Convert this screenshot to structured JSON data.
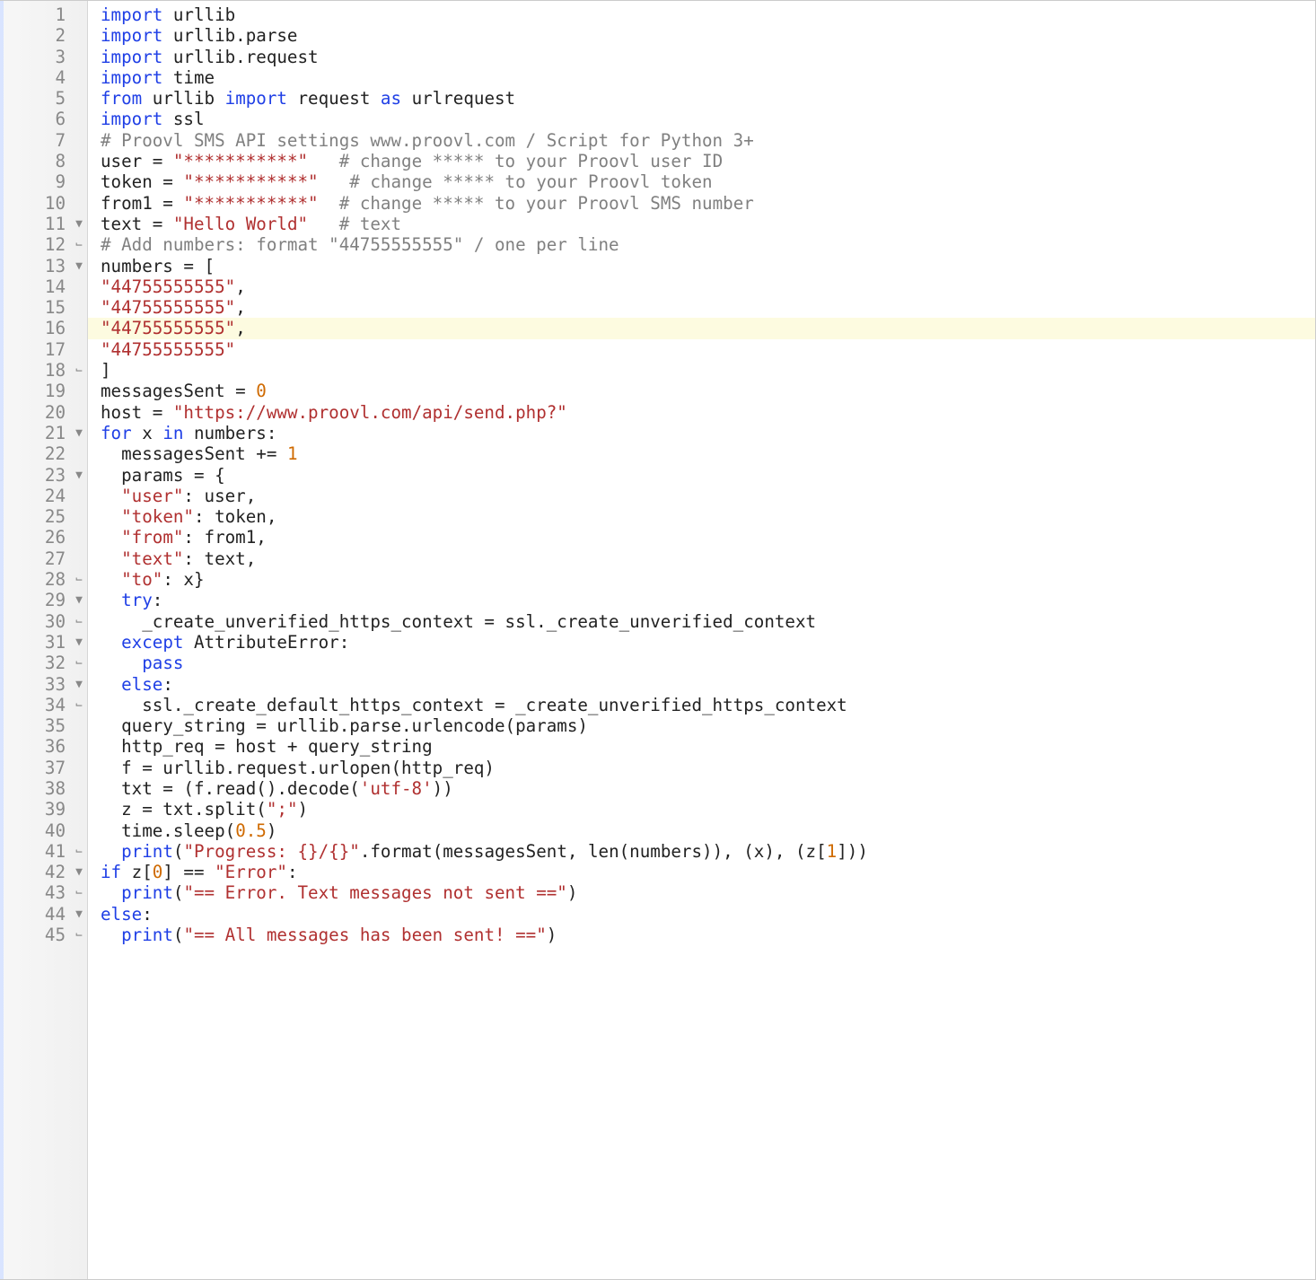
{
  "lines": [
    {
      "n": 1,
      "fold": "",
      "hl": false,
      "tokens": [
        [
          "kw",
          "import"
        ],
        [
          "name",
          " urllib"
        ]
      ]
    },
    {
      "n": 2,
      "fold": "",
      "hl": false,
      "tokens": [
        [
          "kw",
          "import"
        ],
        [
          "name",
          " urllib.parse"
        ]
      ]
    },
    {
      "n": 3,
      "fold": "",
      "hl": false,
      "tokens": [
        [
          "kw",
          "import"
        ],
        [
          "name",
          " urllib.request"
        ]
      ]
    },
    {
      "n": 4,
      "fold": "",
      "hl": false,
      "tokens": [
        [
          "kw",
          "import"
        ],
        [
          "name",
          " time"
        ]
      ]
    },
    {
      "n": 5,
      "fold": "",
      "hl": false,
      "tokens": [
        [
          "kw",
          "from"
        ],
        [
          "name",
          " urllib "
        ],
        [
          "kw",
          "import"
        ],
        [
          "name",
          " request "
        ],
        [
          "kw",
          "as"
        ],
        [
          "name",
          " urlrequest"
        ]
      ]
    },
    {
      "n": 6,
      "fold": "",
      "hl": false,
      "tokens": [
        [
          "kw",
          "import"
        ],
        [
          "name",
          " ssl"
        ]
      ]
    },
    {
      "n": 7,
      "fold": "",
      "hl": false,
      "tokens": [
        [
          "cmt",
          "# Proovl SMS API settings www.proovl.com / Script for Python 3+"
        ]
      ]
    },
    {
      "n": 8,
      "fold": "",
      "hl": false,
      "tokens": [
        [
          "name",
          "user = "
        ],
        [
          "str",
          "\"***********\""
        ],
        [
          "name",
          "   "
        ],
        [
          "cmt",
          "# change ***** to your Proovl user ID"
        ]
      ]
    },
    {
      "n": 9,
      "fold": "",
      "hl": false,
      "tokens": [
        [
          "name",
          "token = "
        ],
        [
          "str",
          "\"***********\""
        ],
        [
          "name",
          "   "
        ],
        [
          "cmt",
          "# change ***** to your Proovl token"
        ]
      ]
    },
    {
      "n": 10,
      "fold": "",
      "hl": false,
      "tokens": [
        [
          "name",
          "from1 = "
        ],
        [
          "str",
          "\"***********\""
        ],
        [
          "name",
          "  "
        ],
        [
          "cmt",
          "# change ***** to your Proovl SMS number"
        ]
      ]
    },
    {
      "n": 11,
      "fold": "▼",
      "hl": false,
      "tokens": [
        [
          "name",
          "text = "
        ],
        [
          "str",
          "\"Hello World\""
        ],
        [
          "name",
          "   "
        ],
        [
          "cmt",
          "# text"
        ]
      ]
    },
    {
      "n": 12,
      "fold": "⌙",
      "hl": false,
      "tokens": [
        [
          "cmt",
          "# Add numbers: format \"44755555555\" / one per line"
        ]
      ]
    },
    {
      "n": 13,
      "fold": "▼",
      "hl": false,
      "tokens": [
        [
          "name",
          "numbers = ["
        ]
      ]
    },
    {
      "n": 14,
      "fold": "",
      "hl": false,
      "tokens": [
        [
          "str",
          "\"44755555555\""
        ],
        [
          "name",
          ","
        ]
      ]
    },
    {
      "n": 15,
      "fold": "",
      "hl": false,
      "tokens": [
        [
          "str",
          "\"44755555555\""
        ],
        [
          "name",
          ","
        ]
      ]
    },
    {
      "n": 16,
      "fold": "",
      "hl": true,
      "tokens": [
        [
          "str",
          "\"44755555555\""
        ],
        [
          "name",
          ","
        ]
      ]
    },
    {
      "n": 17,
      "fold": "",
      "hl": false,
      "tokens": [
        [
          "str",
          "\"44755555555\""
        ]
      ]
    },
    {
      "n": 18,
      "fold": "⌙",
      "hl": false,
      "tokens": [
        [
          "name",
          "]"
        ]
      ]
    },
    {
      "n": 19,
      "fold": "",
      "hl": false,
      "tokens": [
        [
          "name",
          "messagesSent = "
        ],
        [
          "num",
          "0"
        ]
      ]
    },
    {
      "n": 20,
      "fold": "",
      "hl": false,
      "tokens": [
        [
          "name",
          "host = "
        ],
        [
          "str",
          "\"https://www.proovl.com/api/send.php?\""
        ]
      ]
    },
    {
      "n": 21,
      "fold": "▼",
      "hl": false,
      "tokens": [
        [
          "kw",
          "for"
        ],
        [
          "name",
          " x "
        ],
        [
          "kw",
          "in"
        ],
        [
          "name",
          " numbers:"
        ]
      ]
    },
    {
      "n": 22,
      "fold": "",
      "hl": false,
      "tokens": [
        [
          "name",
          "  messagesSent += "
        ],
        [
          "num",
          "1"
        ]
      ]
    },
    {
      "n": 23,
      "fold": "▼",
      "hl": false,
      "tokens": [
        [
          "name",
          "  params = {"
        ]
      ]
    },
    {
      "n": 24,
      "fold": "",
      "hl": false,
      "tokens": [
        [
          "name",
          "  "
        ],
        [
          "str",
          "\"user\""
        ],
        [
          "name",
          ": user,"
        ]
      ]
    },
    {
      "n": 25,
      "fold": "",
      "hl": false,
      "tokens": [
        [
          "name",
          "  "
        ],
        [
          "str",
          "\"token\""
        ],
        [
          "name",
          ": token,"
        ]
      ]
    },
    {
      "n": 26,
      "fold": "",
      "hl": false,
      "tokens": [
        [
          "name",
          "  "
        ],
        [
          "str",
          "\"from\""
        ],
        [
          "name",
          ": from1,"
        ]
      ]
    },
    {
      "n": 27,
      "fold": "",
      "hl": false,
      "tokens": [
        [
          "name",
          "  "
        ],
        [
          "str",
          "\"text\""
        ],
        [
          "name",
          ": text,"
        ]
      ]
    },
    {
      "n": 28,
      "fold": "⌙",
      "hl": false,
      "tokens": [
        [
          "name",
          "  "
        ],
        [
          "str",
          "\"to\""
        ],
        [
          "name",
          ": x}"
        ]
      ]
    },
    {
      "n": 29,
      "fold": "▼",
      "hl": false,
      "tokens": [
        [
          "name",
          "  "
        ],
        [
          "kw",
          "try"
        ],
        [
          "name",
          ":"
        ]
      ]
    },
    {
      "n": 30,
      "fold": "⌙",
      "hl": false,
      "tokens": [
        [
          "name",
          "    _create_unverified_https_context = ssl._create_unverified_context"
        ]
      ]
    },
    {
      "n": 31,
      "fold": "▼",
      "hl": false,
      "tokens": [
        [
          "name",
          "  "
        ],
        [
          "kw",
          "except"
        ],
        [
          "name",
          " AttributeError:"
        ]
      ]
    },
    {
      "n": 32,
      "fold": "⌙",
      "hl": false,
      "tokens": [
        [
          "name",
          "    "
        ],
        [
          "kw",
          "pass"
        ]
      ]
    },
    {
      "n": 33,
      "fold": "▼",
      "hl": false,
      "tokens": [
        [
          "name",
          "  "
        ],
        [
          "kw",
          "else"
        ],
        [
          "name",
          ":"
        ]
      ]
    },
    {
      "n": 34,
      "fold": "⌙",
      "hl": false,
      "tokens": [
        [
          "name",
          "    ssl._create_default_https_context = _create_unverified_https_context"
        ]
      ]
    },
    {
      "n": 35,
      "fold": "",
      "hl": false,
      "tokens": [
        [
          "name",
          "  query_string = urllib.parse.urlencode(params)"
        ]
      ]
    },
    {
      "n": 36,
      "fold": "",
      "hl": false,
      "tokens": [
        [
          "name",
          "  http_req = host + query_string"
        ]
      ]
    },
    {
      "n": 37,
      "fold": "",
      "hl": false,
      "tokens": [
        [
          "name",
          "  f = urllib.request.urlopen(http_req)"
        ]
      ]
    },
    {
      "n": 38,
      "fold": "",
      "hl": false,
      "tokens": [
        [
          "name",
          "  txt = (f.read().decode("
        ],
        [
          "str",
          "'utf-8'"
        ],
        [
          "name",
          "))"
        ]
      ]
    },
    {
      "n": 39,
      "fold": "",
      "hl": false,
      "tokens": [
        [
          "name",
          "  z = txt.split("
        ],
        [
          "str",
          "\";\""
        ],
        [
          "name",
          ")"
        ]
      ]
    },
    {
      "n": 40,
      "fold": "",
      "hl": false,
      "tokens": [
        [
          "name",
          "  time.sleep("
        ],
        [
          "num",
          "0.5"
        ],
        [
          "name",
          ")"
        ]
      ]
    },
    {
      "n": 41,
      "fold": "⌙",
      "hl": false,
      "tokens": [
        [
          "name",
          "  "
        ],
        [
          "kw",
          "print"
        ],
        [
          "name",
          "("
        ],
        [
          "str",
          "\"Progress: {}/{}\""
        ],
        [
          "name",
          ".format(messagesSent, len(numbers)), (x), (z["
        ],
        [
          "num",
          "1"
        ],
        [
          "name",
          "]))"
        ]
      ]
    },
    {
      "n": 42,
      "fold": "▼",
      "hl": false,
      "tokens": [
        [
          "kw",
          "if"
        ],
        [
          "name",
          " z["
        ],
        [
          "num",
          "0"
        ],
        [
          "name",
          "] == "
        ],
        [
          "str",
          "\"Error\""
        ],
        [
          "name",
          ":"
        ]
      ]
    },
    {
      "n": 43,
      "fold": "⌙",
      "hl": false,
      "tokens": [
        [
          "name",
          "  "
        ],
        [
          "kw",
          "print"
        ],
        [
          "name",
          "("
        ],
        [
          "str",
          "\"== Error. Text messages not sent ==\""
        ],
        [
          "name",
          ")"
        ]
      ]
    },
    {
      "n": 44,
      "fold": "▼",
      "hl": false,
      "tokens": [
        [
          "kw",
          "else"
        ],
        [
          "name",
          ":"
        ]
      ]
    },
    {
      "n": 45,
      "fold": "⌙",
      "hl": false,
      "tokens": [
        [
          "name",
          "  "
        ],
        [
          "kw",
          "print"
        ],
        [
          "name",
          "("
        ],
        [
          "str",
          "\"== All messages has been sent! ==\""
        ],
        [
          "name",
          ")"
        ]
      ]
    }
  ]
}
